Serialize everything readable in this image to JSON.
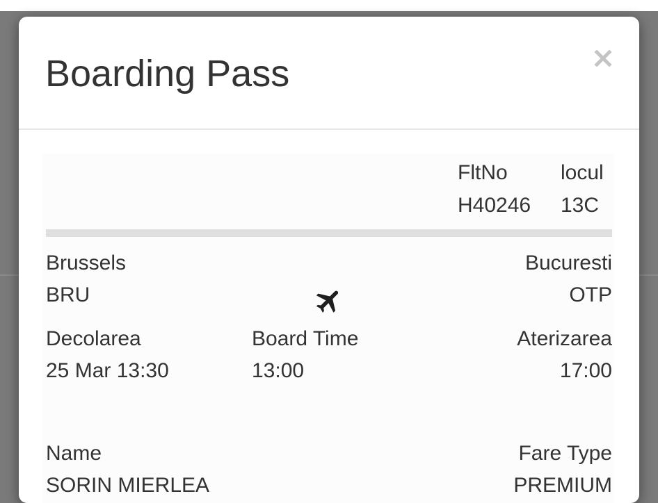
{
  "modal": {
    "title": "Boarding Pass",
    "close_label": "×"
  },
  "flight": {
    "flight_no_label": "FltNo",
    "flight_no": "H40246",
    "seat_label": "locul",
    "seat": "13C"
  },
  "route": {
    "origin_city": "Brussels",
    "origin_code": "BRU",
    "destination_city": "Bucuresti",
    "destination_code": "OTP",
    "icon": "airplane-icon"
  },
  "times": {
    "departure_label": "Decolarea",
    "departure_value": "25 Mar 13:30",
    "board_label": "Board Time",
    "board_value": "13:00",
    "arrival_label": "Aterizarea",
    "arrival_value": "17:00"
  },
  "passenger": {
    "name_label": "Name",
    "name_value": "SORIN MIERLEA",
    "fare_label": "Fare Type",
    "fare_value": "PREMIUM"
  },
  "colors": {
    "backdrop": "#7a7a7a",
    "text": "#333333",
    "divider": "#dfdfdf",
    "close_icon": "#c4c4c4"
  }
}
